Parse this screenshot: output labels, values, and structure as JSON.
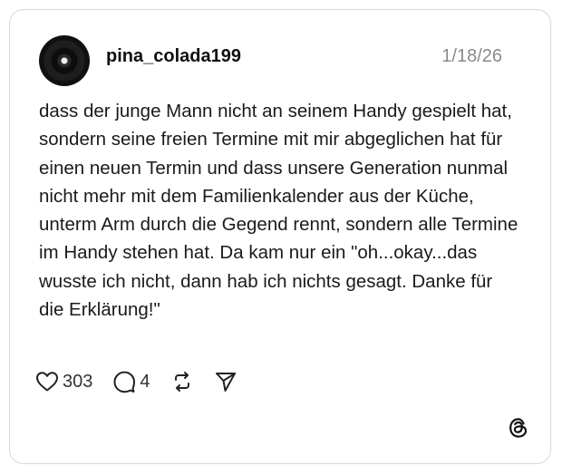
{
  "post": {
    "username": "pina_colada199",
    "date": "1/18/26",
    "text": "dass der junge Mann nicht an seinem Handy gespielt hat, sondern seine freien Termine mit mir abgeglichen hat für einen neuen Termin und dass unsere Generation nunmal nicht mehr mit dem Familienkalender aus der Küche, unterm Arm durch die Gegend rennt, sondern alle Termine im Handy stehen hat. Da kam nur ein \"oh...okay...das wusste ich nicht, dann hab ich nichts gesagt. Danke für die Erklärung!\""
  },
  "actions": {
    "likes": "303",
    "replies": "4"
  },
  "icons": {
    "like": "heart-icon",
    "reply": "speech-bubble-icon",
    "repost": "repost-arrows-icon",
    "share": "send-icon",
    "brand": "threads-logo-icon"
  }
}
